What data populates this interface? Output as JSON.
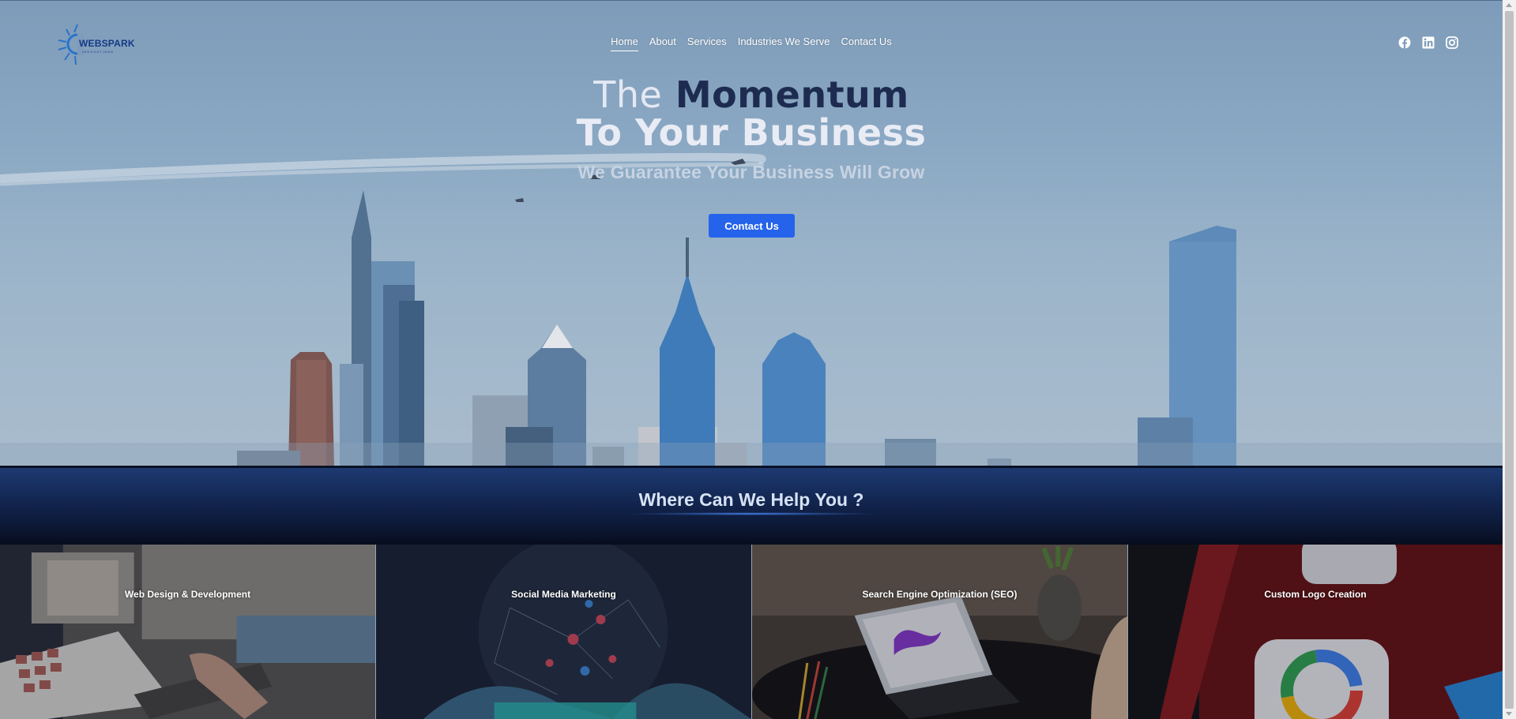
{
  "brand": {
    "name": "WEBSPARK",
    "tagline": "INNOVATIONS",
    "color": "#153a86"
  },
  "nav": {
    "items": [
      {
        "label": "Home",
        "active": true
      },
      {
        "label": "About",
        "active": false
      },
      {
        "label": "Services",
        "active": false
      },
      {
        "label": "Industries We Serve",
        "active": false
      },
      {
        "label": "Contact Us",
        "active": false
      }
    ]
  },
  "socials": [
    {
      "icon": "facebook-icon"
    },
    {
      "icon": "linkedin-icon"
    },
    {
      "icon": "instagram-icon"
    }
  ],
  "hero": {
    "title_light": "The",
    "title_strong": "Momentum",
    "title_line2": "To Your Business",
    "subtitle": "We Guarantee Your Business Will Grow",
    "cta_label": "Contact Us",
    "cta_color": "#2563eb"
  },
  "help": {
    "heading": "Where Can We Help You ?"
  },
  "services": [
    {
      "title": "Web Design & Development"
    },
    {
      "title": "Social Media Marketing"
    },
    {
      "title": "Search Engine Optimization (SEO)"
    },
    {
      "title": "Custom Logo Creation"
    }
  ]
}
